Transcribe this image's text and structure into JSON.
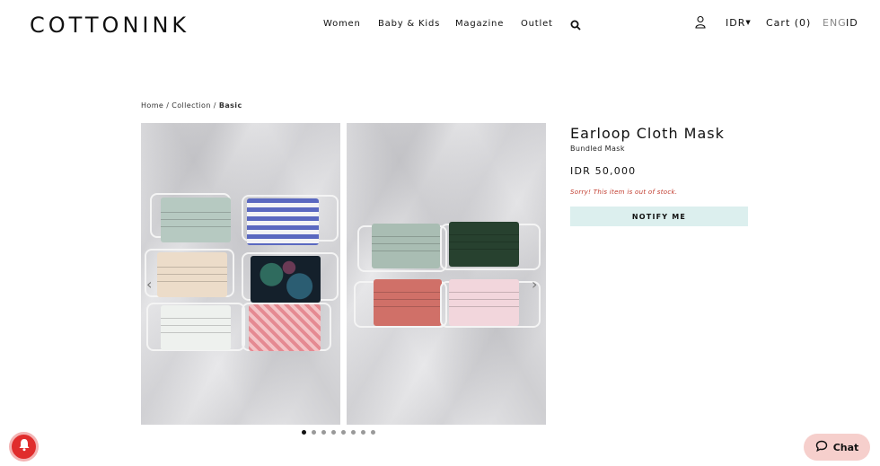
{
  "header": {
    "logo": "COTTONINK",
    "nav": [
      "Women",
      "Baby & Kids",
      "Magazine",
      "Outlet"
    ],
    "currency": "IDR",
    "cart": "Cart (0)",
    "lang_eng": "ENG",
    "lang_id": "ID"
  },
  "breadcrumb": {
    "home": "Home",
    "sep1": "/",
    "collection": "Collection",
    "sep2": "/",
    "current": "Basic"
  },
  "product": {
    "title": "Earloop Cloth Mask",
    "subtitle": "Bundled Mask",
    "price": "IDR 50,000",
    "stock_message": "Sorry! This item is out of stock.",
    "notify_label": "NOTIFY ME"
  },
  "gallery": {
    "slide_count": 8,
    "active_index": 0,
    "image_left": "photo-1",
    "image_right": "photo-2"
  },
  "chat": {
    "label": "Chat"
  },
  "colors": {
    "notify_bg": "#dcefee",
    "stock_text": "#c0392b",
    "bell": "#e02c2c",
    "chat_bg": "#f6cfcc"
  }
}
